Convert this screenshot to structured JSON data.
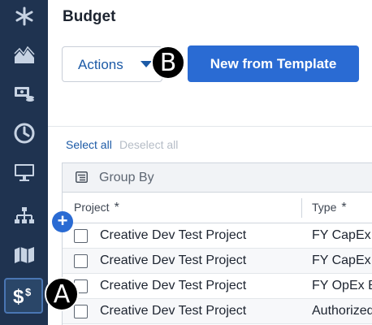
{
  "sidebar": {
    "items": [
      {
        "icon": "asterisk-icon"
      },
      {
        "icon": "area-chart-icon"
      },
      {
        "icon": "money-coins-icon"
      },
      {
        "icon": "clock-icon"
      },
      {
        "icon": "monitor-icon"
      },
      {
        "icon": "hierarchy-icon"
      },
      {
        "icon": "map-icon"
      },
      {
        "icon": "dollar-icon",
        "active": true
      }
    ]
  },
  "page": {
    "title": "Budget",
    "actions_label": "Actions",
    "new_template_label": "New from Template",
    "select_all": "Select all",
    "deselect_all": "Deselect all"
  },
  "table": {
    "group_by_label": "Group By",
    "headers": {
      "project": "Project",
      "type": "Type",
      "required_mark": "*"
    },
    "rows": [
      {
        "project": "Creative Dev Test Project",
        "type": "FY CapEx B"
      },
      {
        "project": "Creative Dev Test Project",
        "type": "FY CapEx B"
      },
      {
        "project": "Creative Dev Test Project",
        "type": "FY OpEx B"
      },
      {
        "project": "Creative Dev Test Project",
        "type": "Authorized"
      }
    ]
  },
  "add_button": "+",
  "markers": {
    "a": "A",
    "b": "B"
  },
  "colors": {
    "sidebar": "#1f3350",
    "accent": "#2a6bd3",
    "link": "#1c5aa6"
  }
}
